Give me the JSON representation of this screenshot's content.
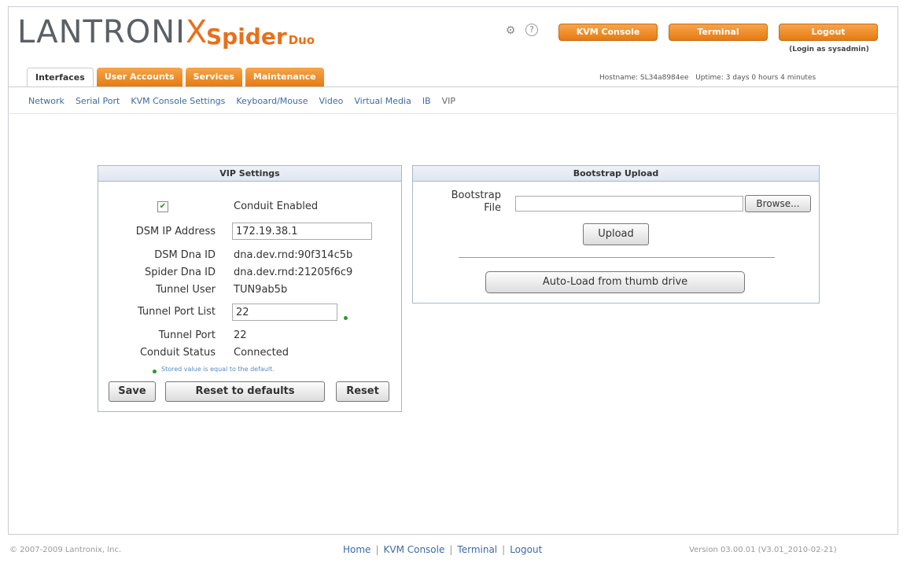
{
  "header": {
    "logo_text_a": "LANTR",
    "logo_text_b": "ONI",
    "logo_text_x": "X",
    "product_name": "Spider",
    "product_sub": "Duo",
    "buttons": {
      "kvm_console": "KVM Console",
      "terminal": "Terminal",
      "logout": "Logout"
    },
    "login_as": "(Login as sysadmin)"
  },
  "tabs": [
    {
      "label": "Interfaces",
      "active": true
    },
    {
      "label": "User Accounts",
      "active": false
    },
    {
      "label": "Services",
      "active": false
    },
    {
      "label": "Maintenance",
      "active": false
    }
  ],
  "host_info": {
    "hostname": "Hostname: SL34a8984ee",
    "uptime": "Uptime: 3 days 0 hours 4 minutes"
  },
  "subnav": [
    {
      "label": "Network"
    },
    {
      "label": "Serial Port"
    },
    {
      "label": "KVM Console Settings"
    },
    {
      "label": "Keyboard/Mouse"
    },
    {
      "label": "Video"
    },
    {
      "label": "Virtual Media"
    },
    {
      "label": "IB"
    },
    {
      "label": "VIP",
      "current": true
    }
  ],
  "vip_settings": {
    "title": "VIP Settings",
    "conduit_enabled_label": "Conduit Enabled",
    "conduit_enabled_checked": true,
    "dsm_ip_label": "DSM IP Address",
    "dsm_ip_value": "172.19.38.1",
    "dsm_dna_label": "DSM Dna ID",
    "dsm_dna_value": "dna.dev.rnd:90f314c5b",
    "spider_dna_label": "Spider Dna ID",
    "spider_dna_value": "dna.dev.rnd:21205f6c9",
    "tunnel_user_label": "Tunnel User",
    "tunnel_user_value": "TUN9ab5b",
    "tunnel_port_list_label": "Tunnel Port List",
    "tunnel_port_list_value": "22",
    "tunnel_port_label": "Tunnel Port",
    "tunnel_port_value": "22",
    "conduit_status_label": "Conduit Status",
    "conduit_status_value": "Connected",
    "note": "Stored value is equal to the default.",
    "save_label": "Save",
    "reset_defaults_label": "Reset to defaults",
    "reset_label": "Reset"
  },
  "bootstrap": {
    "title": "Bootstrap Upload",
    "file_label_1": "Bootstrap",
    "file_label_2": "File",
    "file_value": "",
    "browse_label": "Browse...",
    "upload_label": "Upload",
    "autoload_label": "Auto-Load from thumb drive"
  },
  "footer": {
    "copyright": "© 2007-2009 Lantronix, Inc.",
    "links": [
      "Home",
      "KVM Console",
      "Terminal",
      "Logout"
    ],
    "version": "Version 03.00.01 (V3.01_2010-02-21)"
  }
}
